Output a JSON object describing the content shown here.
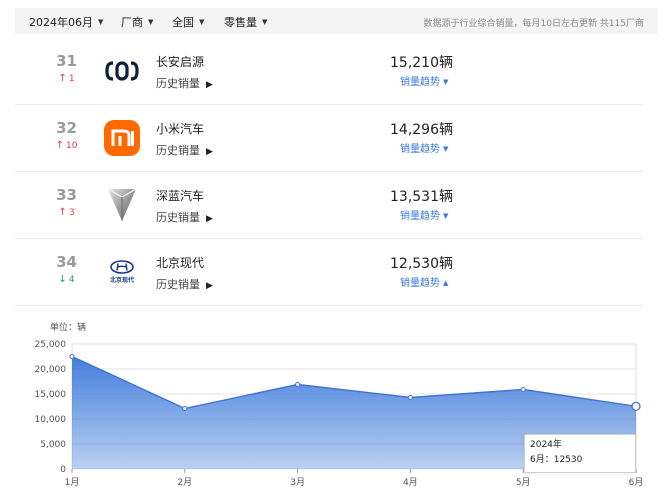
{
  "filters": {
    "month": "2024年06月",
    "maker": "厂商",
    "region": "全国",
    "channel": "零售量",
    "note": "数据源于行业综合销量，每月10日左右更新 共115厂商"
  },
  "rows": [
    {
      "rank": "31",
      "change": "1",
      "direction": "up",
      "brand": "长安启源",
      "history": "历史销量",
      "sales": "15,210辆",
      "trend": "销量趋势",
      "logo_icon": "changan-qiyuan-logo-icon",
      "expanded": false
    },
    {
      "rank": "32",
      "change": "10",
      "direction": "up",
      "brand": "小米汽车",
      "history": "历史销量",
      "sales": "14,296辆",
      "trend": "销量趋势",
      "logo_icon": "xiaomi-logo-icon",
      "expanded": false
    },
    {
      "rank": "33",
      "change": "3",
      "direction": "up",
      "brand": "深蓝汽车",
      "history": "历史销量",
      "sales": "13,531辆",
      "trend": "销量趋势",
      "logo_icon": "deepal-logo-icon",
      "expanded": false
    },
    {
      "rank": "34",
      "change": "4",
      "direction": "down",
      "brand": "北京现代",
      "history": "历史销量",
      "sales": "12,530辆",
      "trend": "销量趋势",
      "logo_icon": "beijing-hyundai-logo-icon",
      "logo_text": "北京现代",
      "expanded": true
    }
  ],
  "colors": {
    "up": "#e23b3b",
    "down": "#1fa554",
    "accent": "#3a78d9",
    "xiaomi": "#ff6900"
  },
  "tooltip": {
    "year": "2024年",
    "label": "6月：12530"
  },
  "chart_data": {
    "type": "area",
    "unit_label": "单位：辆",
    "categories": [
      "1月",
      "2月",
      "3月",
      "4月",
      "5月",
      "6月"
    ],
    "values": [
      22500,
      12100,
      16900,
      14300,
      15900,
      12530
    ],
    "yticks": [
      "0",
      "5,000",
      "10,000",
      "15,000",
      "20,000",
      "25,000"
    ],
    "ylim": [
      0,
      25000
    ],
    "grid": "horizontal",
    "highlight_index": 5,
    "color": "#3a78d9"
  }
}
